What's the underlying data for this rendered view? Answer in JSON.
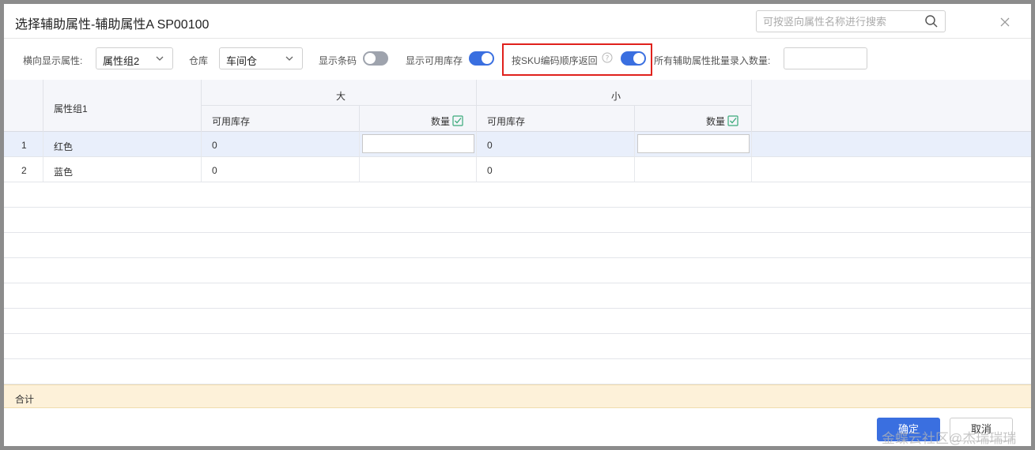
{
  "dialog": {
    "title": "选择辅助属性-辅助属性A  SP00100",
    "search_placeholder": "可按竖向属性名称进行搜索"
  },
  "toolbar": {
    "horizontal_label": "横向显示属性:",
    "horizontal_value": "属性组2",
    "warehouse_label": "仓库",
    "warehouse_value": "车间仓",
    "show_barcode_label": "显示条码",
    "show_barcode_on": false,
    "show_stock_label": "显示可用库存",
    "show_stock_on": true,
    "sku_order_label": "按SKU编码顺序返回",
    "sku_order_on": true,
    "batch_label": "所有辅助属性批量录入数量:",
    "batch_value": ""
  },
  "table": {
    "row_header": "属性组1",
    "groups": [
      {
        "name": "大",
        "stock_header": "可用库存",
        "qty_header": "数量"
      },
      {
        "name": "小",
        "stock_header": "可用库存",
        "qty_header": "数量"
      }
    ],
    "rows": [
      {
        "index": "1",
        "name": "红色",
        "stock_big": "0",
        "stock_small": "0"
      },
      {
        "index": "2",
        "name": "蓝色",
        "stock_big": "0",
        "stock_small": "0"
      }
    ]
  },
  "summary": {
    "label": "合计"
  },
  "footer": {
    "ok_label": "确定",
    "cancel_label": "取消",
    "watermark": "金蝶云社区@杰瑞瑞瑞"
  },
  "colors": {
    "accent": "#3a6fe0",
    "highlight_border": "#e0211c",
    "total_bg": "#fdf1d9"
  }
}
